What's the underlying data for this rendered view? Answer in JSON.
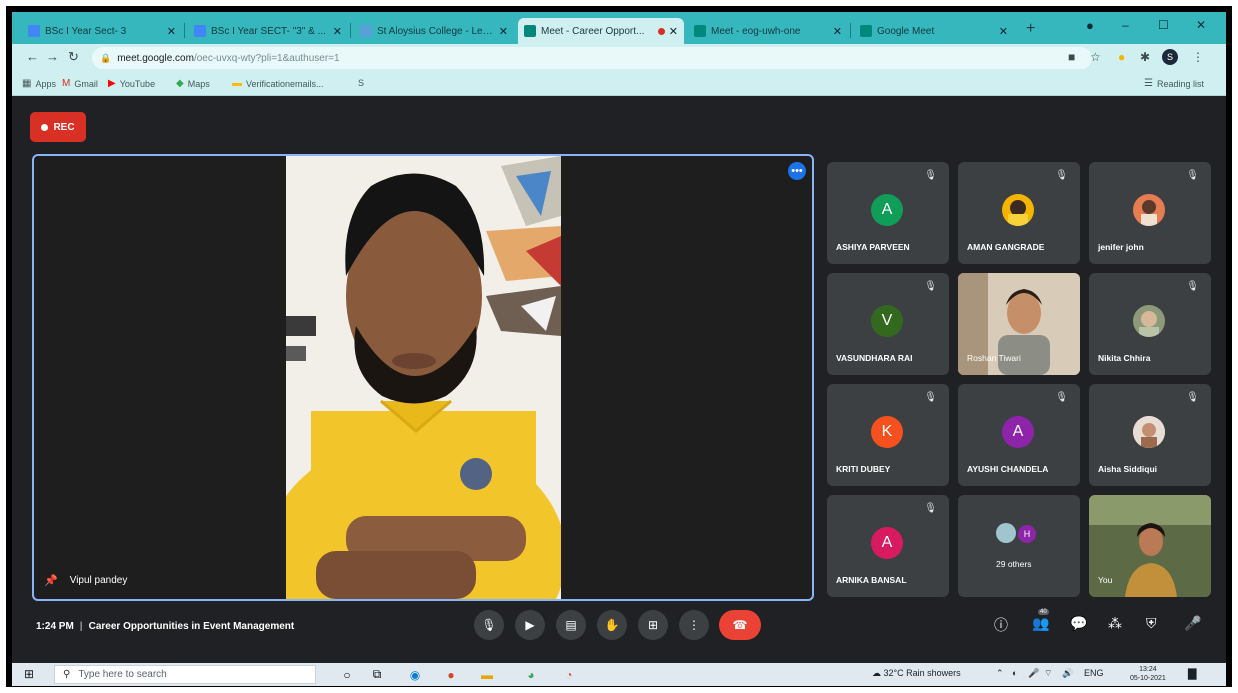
{
  "browser": {
    "tabs": [
      {
        "title": "BSc I Year Sect- 3",
        "icon_color": "#4285f4",
        "active": false
      },
      {
        "title": "BSc I Year SECT- \"3\" & ...",
        "icon_color": "#4285f4",
        "active": false
      },
      {
        "title": "St Aloysius College - Learn...",
        "icon_color": "#5aa0d8",
        "active": false
      },
      {
        "title": "Meet - Career Opport...",
        "icon_color": "#00897b",
        "active": true
      },
      {
        "title": "Meet - eog-uwh-one",
        "icon_color": "#00897b",
        "active": false
      },
      {
        "title": "Google Meet",
        "icon_color": "#00897b",
        "active": false
      }
    ],
    "new_tab": "+",
    "window_controls": {
      "minimize": "–",
      "maximize": "☐",
      "close": "✕"
    },
    "url": {
      "host": "meet.google.com",
      "rest": "/oec-uvxq-wty?pli=1&authuser=1"
    },
    "bookmarks": [
      {
        "label": "Apps",
        "icon": "grid-icon"
      },
      {
        "label": "Gmail",
        "icon": "gmail-icon"
      },
      {
        "label": "YouTube",
        "icon": "youtube-icon"
      },
      {
        "label": "Maps",
        "icon": "maps-icon"
      },
      {
        "label": "Verificationemails...",
        "icon": "bookmark-icon"
      },
      {
        "label": "S",
        "icon": "bookmark-icon"
      }
    ],
    "reading_list": "Reading list"
  },
  "meet": {
    "rec_label": "REC",
    "presenter_name": "Vipul pandey",
    "participants": [
      {
        "name": "ASHIYA PARVEEN",
        "initial": "A",
        "avatar_color": "#0f9d58",
        "kind": "initial"
      },
      {
        "name": "AMAN GANGRADE",
        "initial": "",
        "avatar_color": "#f4b400",
        "kind": "photo"
      },
      {
        "name": "jenifer john",
        "initial": "",
        "avatar_color": "#e67c52",
        "kind": "photo"
      },
      {
        "name": "VASUNDHARA RAI",
        "initial": "V",
        "avatar_color": "#33691e",
        "kind": "initial"
      },
      {
        "name": "Roshan Tiwari",
        "initial": "",
        "avatar_color": "#b07a4f",
        "kind": "video"
      },
      {
        "name": "Nikita Chhira",
        "initial": "",
        "avatar_color": "#8d9a7a",
        "kind": "photo"
      },
      {
        "name": "KRITI DUBEY",
        "initial": "K",
        "avatar_color": "#f4511e",
        "kind": "initial"
      },
      {
        "name": "AYUSHI CHANDELA",
        "initial": "A",
        "avatar_color": "#8e24aa",
        "kind": "initial"
      },
      {
        "name": "Aisha Siddiqui",
        "initial": "",
        "avatar_color": "#c9a28a",
        "kind": "photo"
      },
      {
        "name": "ARNIKA BANSAL",
        "initial": "A",
        "avatar_color": "#d81b60",
        "kind": "initial"
      },
      {
        "name": "29 others",
        "initial": "H",
        "avatar_color": "#8e24aa",
        "kind": "others"
      },
      {
        "name": "You",
        "initial": "",
        "avatar_color": "#5d6b45",
        "kind": "self"
      }
    ],
    "time": "1:24 PM",
    "meeting_title": "Career Opportunities in Event Management",
    "controls": [
      "mic-icon",
      "camera-icon",
      "captions-icon",
      "raise-hand-icon",
      "present-icon",
      "more-options-icon",
      "end-call-icon"
    ],
    "right_controls": [
      "info-icon",
      "people-icon",
      "chat-icon",
      "activities-icon",
      "host-controls-icon",
      "mic-indicator-icon"
    ],
    "people_count": "40"
  },
  "taskbar": {
    "search_placeholder": "Type here to search",
    "weather": "32°C Rain showers",
    "language": "ENG",
    "time": "13:24",
    "date": "05-10-2021"
  }
}
